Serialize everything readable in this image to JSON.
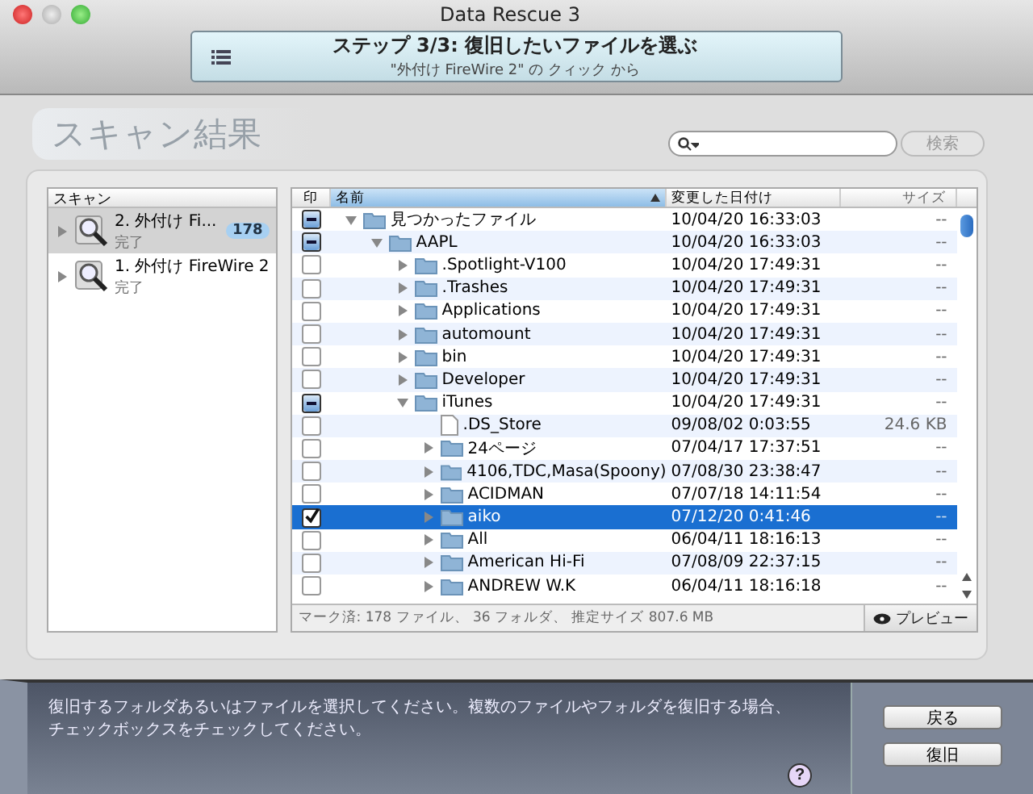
{
  "window": {
    "title": "Data Rescue 3"
  },
  "step": {
    "title": "ステップ 3/3: 復旧したいファイルを選ぶ",
    "subtitle": "\"外付け FireWire 2\" の クィック から"
  },
  "heading": "スキャン結果",
  "search": {
    "button": "検索"
  },
  "scans": {
    "header": "スキャン",
    "items": [
      {
        "name": "2. 外付け Fi...",
        "status": "完了",
        "badge": "178",
        "selected": true,
        "expanded": false
      },
      {
        "name": "1. 外付け FireWire 2",
        "status": "完了",
        "selected": false,
        "expanded": false
      }
    ]
  },
  "table": {
    "columns": [
      {
        "label": "印",
        "sorted": false
      },
      {
        "label": "名前",
        "sorted": true
      },
      {
        "label": "変更した日付け",
        "sorted": false
      },
      {
        "label": "サイズ",
        "sorted": false
      }
    ],
    "rows": [
      {
        "kind": "folder",
        "name": "見つかったファイル",
        "modified": "10/04/20 16:33:03",
        "size": "--",
        "checked": true,
        "mixed": true,
        "selected": false,
        "expanded": true,
        "children": [
          {
            "kind": "folder",
            "name": "AAPL",
            "modified": "10/04/20 16:33:03",
            "size": "--",
            "checked": true,
            "mixed": true,
            "selected": false,
            "expanded": true,
            "children": [
              {
                "kind": "folder",
                "name": ".Spotlight-V100",
                "modified": "10/04/20 17:49:31",
                "size": "--",
                "checked": false,
                "mixed": false,
                "selected": false,
                "expanded": false
              },
              {
                "kind": "folder",
                "name": ".Trashes",
                "modified": "10/04/20 17:49:31",
                "size": "--",
                "checked": false,
                "mixed": false,
                "selected": false,
                "expanded": false
              },
              {
                "kind": "folder",
                "name": "Applications",
                "modified": "10/04/20 17:49:31",
                "size": "--",
                "checked": false,
                "mixed": false,
                "selected": false,
                "expanded": false
              },
              {
                "kind": "folder",
                "name": "automount",
                "modified": "10/04/20 17:49:31",
                "size": "--",
                "checked": false,
                "mixed": false,
                "selected": false,
                "expanded": false
              },
              {
                "kind": "folder",
                "name": "bin",
                "modified": "10/04/20 17:49:31",
                "size": "--",
                "checked": false,
                "mixed": false,
                "selected": false,
                "expanded": false
              },
              {
                "kind": "folder",
                "name": "Developer",
                "modified": "10/04/20 17:49:31",
                "size": "--",
                "checked": false,
                "mixed": false,
                "selected": false,
                "expanded": false
              },
              {
                "kind": "folder",
                "name": "iTunes",
                "modified": "10/04/20 17:49:31",
                "size": "--",
                "checked": true,
                "mixed": true,
                "selected": false,
                "expanded": true,
                "children": [
                  {
                    "kind": "file",
                    "name": ".DS_Store",
                    "modified": "09/08/02 0:03:55",
                    "size": "24.6 KB",
                    "checked": false,
                    "mixed": false,
                    "selected": false
                  },
                  {
                    "kind": "folder",
                    "name": "24ページ",
                    "modified": "07/04/17 17:37:51",
                    "size": "--",
                    "checked": false,
                    "mixed": false,
                    "selected": false,
                    "expanded": false
                  },
                  {
                    "kind": "folder",
                    "name": "4106,TDC,Masa(Spoony)",
                    "modified": "07/08/30 23:38:47",
                    "size": "--",
                    "checked": false,
                    "mixed": false,
                    "selected": false,
                    "expanded": false
                  },
                  {
                    "kind": "folder",
                    "name": "ACIDMAN",
                    "modified": "07/07/18 14:11:54",
                    "size": "--",
                    "checked": false,
                    "mixed": false,
                    "selected": false,
                    "expanded": false
                  },
                  {
                    "kind": "folder",
                    "name": "aiko",
                    "modified": "07/12/20 0:41:46",
                    "size": "--",
                    "checked": true,
                    "mixed": false,
                    "selected": true,
                    "expanded": false
                  },
                  {
                    "kind": "folder",
                    "name": "All",
                    "modified": "06/04/11 18:16:13",
                    "size": "--",
                    "checked": false,
                    "mixed": false,
                    "selected": false,
                    "expanded": false
                  },
                  {
                    "kind": "folder",
                    "name": "American Hi-Fi",
                    "modified": "07/08/09 22:37:15",
                    "size": "--",
                    "checked": false,
                    "mixed": false,
                    "selected": false,
                    "expanded": false
                  },
                  {
                    "kind": "folder",
                    "name": "ANDREW W.K",
                    "modified": "06/04/11 18:16:18",
                    "size": "--",
                    "checked": false,
                    "mixed": false,
                    "selected": false,
                    "expanded": false
                  }
                ]
              }
            ]
          }
        ]
      }
    ]
  },
  "status_bar": {
    "text": "マーク済: 178 ファイル、 36 フォルダ、 推定サイズ 807.6 MB",
    "preview": "プレビュー"
  },
  "footer": {
    "message": "復旧するフォルダあるいはファイルを選択してください。複数のファイルやフォルダを復旧する場合、チェックボックスをチェックしてください。",
    "help": "?",
    "buttons": [
      "戻る",
      "復旧"
    ]
  }
}
